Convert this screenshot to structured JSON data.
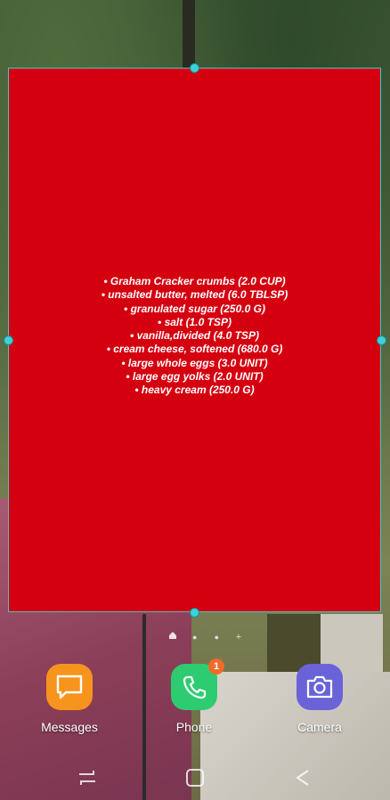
{
  "widget": {
    "ingredients": [
      "• Graham Cracker crumbs (2.0 CUP)",
      "• unsalted butter, melted (6.0 TBLSP)",
      "• granulated sugar (250.0 G)",
      "• salt (1.0 TSP)",
      "• vanilla,divided (4.0 TSP)",
      "• cream cheese, softened (680.0 G)",
      "• large whole eggs (3.0 UNIT)",
      "• large egg yolks (2.0 UNIT)",
      "• heavy cream (250.0 G)"
    ],
    "background_color": "#d40010",
    "frame_color": "#3ec7cf"
  },
  "page_indicators": {
    "home_icon": "home-icon",
    "add_icon": "plus-icon",
    "add_label": "+"
  },
  "dock": {
    "apps": [
      {
        "label": "Messages",
        "icon": "message-icon",
        "color": "#f7941d"
      },
      {
        "label": "Phone",
        "icon": "phone-icon",
        "color": "#2ecc71",
        "badge": "1"
      },
      {
        "label": "Camera",
        "icon": "camera-icon",
        "color": "#6a63d8"
      }
    ]
  },
  "navbar": {
    "buttons": [
      "recents-icon",
      "home-icon",
      "back-icon"
    ]
  }
}
